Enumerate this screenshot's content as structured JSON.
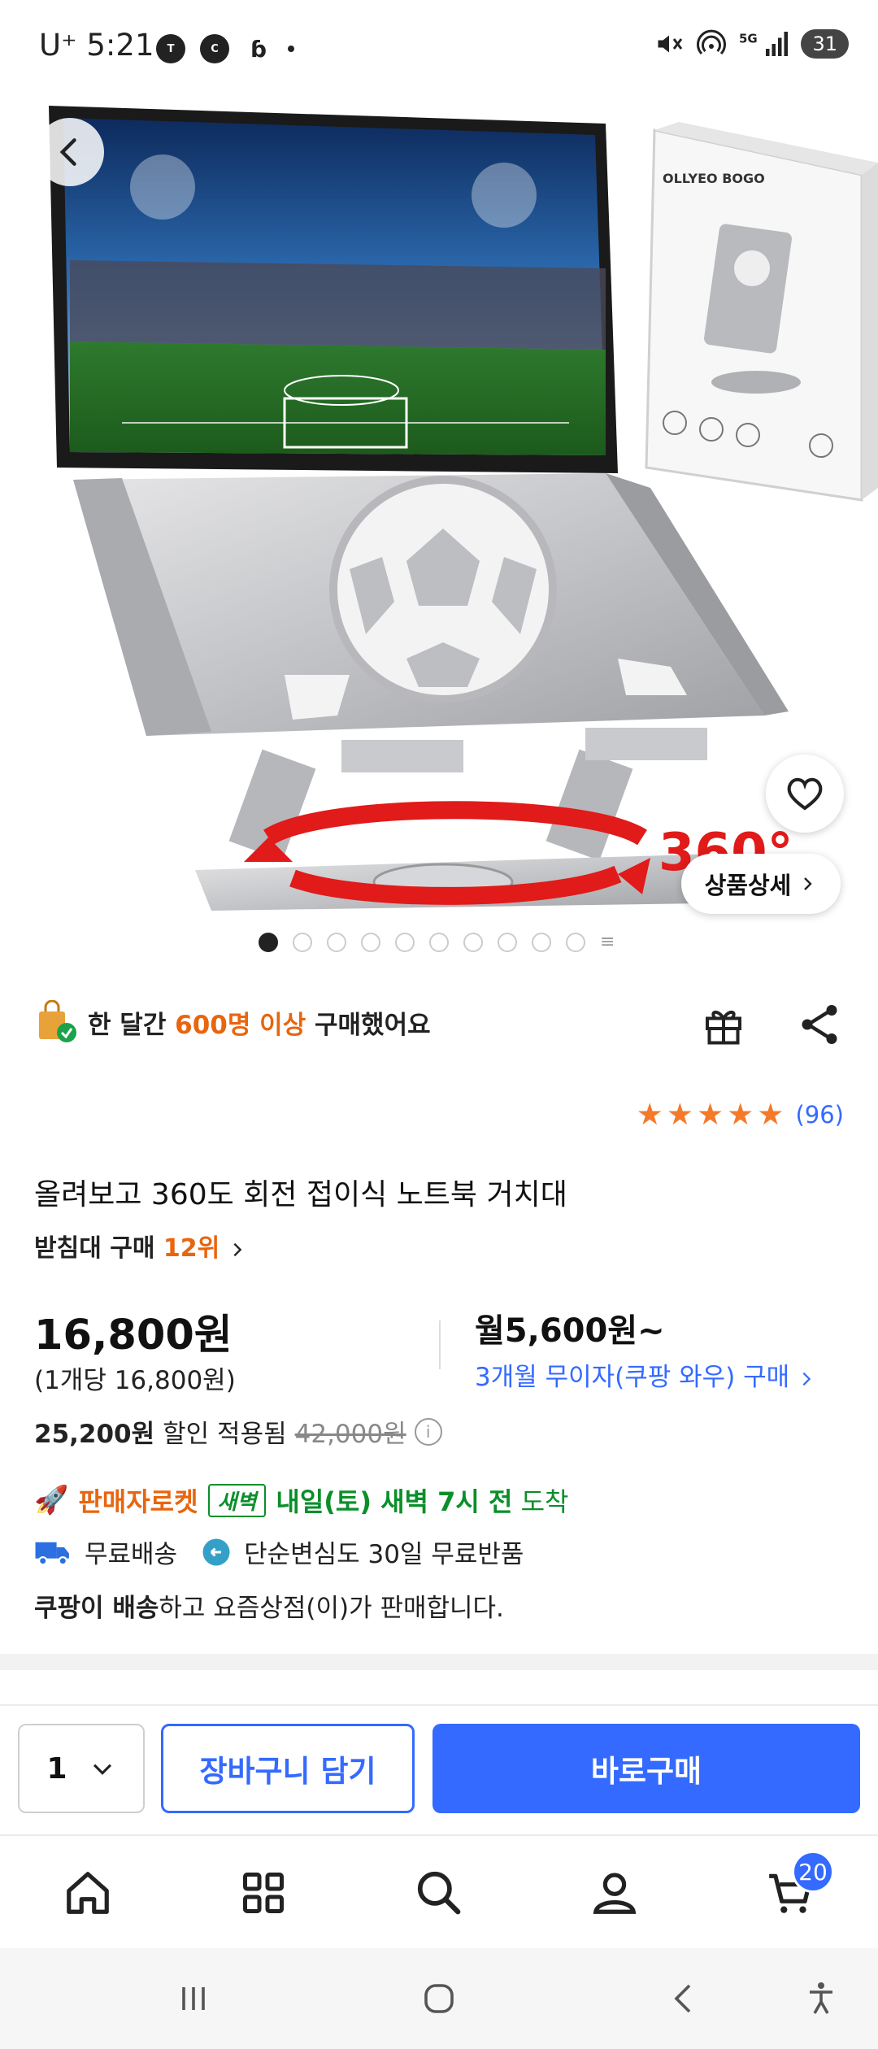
{
  "status_bar": {
    "carrier": "U⁺",
    "time": "5:21",
    "battery": "31"
  },
  "product_image": {
    "detail_button_label": "상품상세",
    "carousel_total": 11,
    "carousel_active_index": 0
  },
  "purchase_info": {
    "prefix": "한 달간 ",
    "highlight": "600명 이상",
    "suffix": " 구매했어요"
  },
  "rating": {
    "stars": 5,
    "count": "(96)"
  },
  "product": {
    "title": "올려보고 360도 회전 접이식 노트북 거치대",
    "rank_category": "받침대 구매 ",
    "rank_value": "12위"
  },
  "pricing": {
    "price": "16,800원",
    "unit_price": "(1개당 16,800원)",
    "monthly": "월5,600원~",
    "installment": "3개월 무이자(쿠팡 와우) 구매",
    "discount_amount": "25,200원",
    "discount_label": "할인 적용됨",
    "original_price": "42,000원"
  },
  "delivery": {
    "rocket_label": "판매자로켓",
    "dawn_badge": "새벽",
    "arrival_bold": "내일(토) 새벽 7시 전",
    "arrival_tail": " 도착",
    "free_shipping": "무료배송",
    "free_return": "단순변심도 30일 무료반품",
    "seller_bold": "쿠팡이 배송",
    "seller_rest": "하고 요즘상점(이)가 판매합니다."
  },
  "actions": {
    "quantity": "1",
    "cart_label": "장바구니 담기",
    "buy_label": "바로구매"
  },
  "tab_bar": {
    "cart_count": "20"
  },
  "colors": {
    "accent_blue": "#346aff",
    "highlight_orange": "#e8650f",
    "delivery_green": "#0a8f2a",
    "star_orange": "#f47a2a"
  }
}
